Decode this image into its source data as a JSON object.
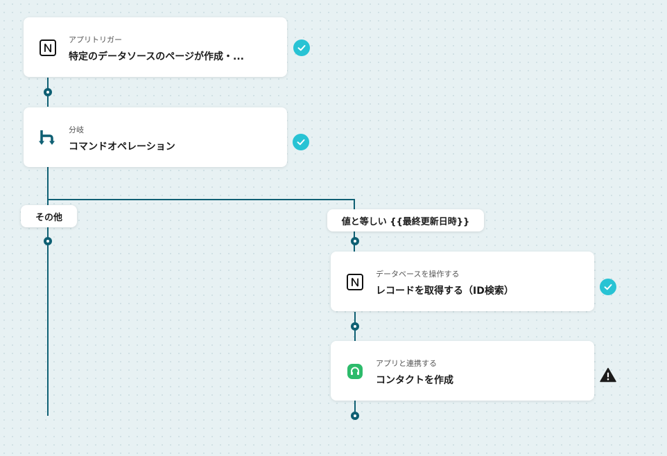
{
  "flow": {
    "trigger": {
      "subtitle": "アプリトリガー",
      "title": "特定のデータソースのページが作成・...",
      "icon": "notion-icon",
      "status": "done"
    },
    "branch": {
      "subtitle": "分岐",
      "title": "コマンドオペレーション",
      "icon": "branch-icon",
      "status": "done"
    },
    "paths": {
      "other": {
        "label": "その他"
      },
      "equals": {
        "label": "値と等しい {{最終更新日時}}"
      }
    },
    "get_record": {
      "subtitle": "データベースを操作する",
      "title": "レコードを取得する（ID検索）",
      "icon": "notion-icon",
      "status": "done"
    },
    "create_contact": {
      "subtitle": "アプリと連携する",
      "title": "コンタクトを作成",
      "icon": "headset-app-icon",
      "status": "warning"
    }
  },
  "colors": {
    "accent": "#0e5f73",
    "check": "#28c3d4",
    "card_bg": "#ffffff",
    "canvas": "#e7f1f3"
  }
}
